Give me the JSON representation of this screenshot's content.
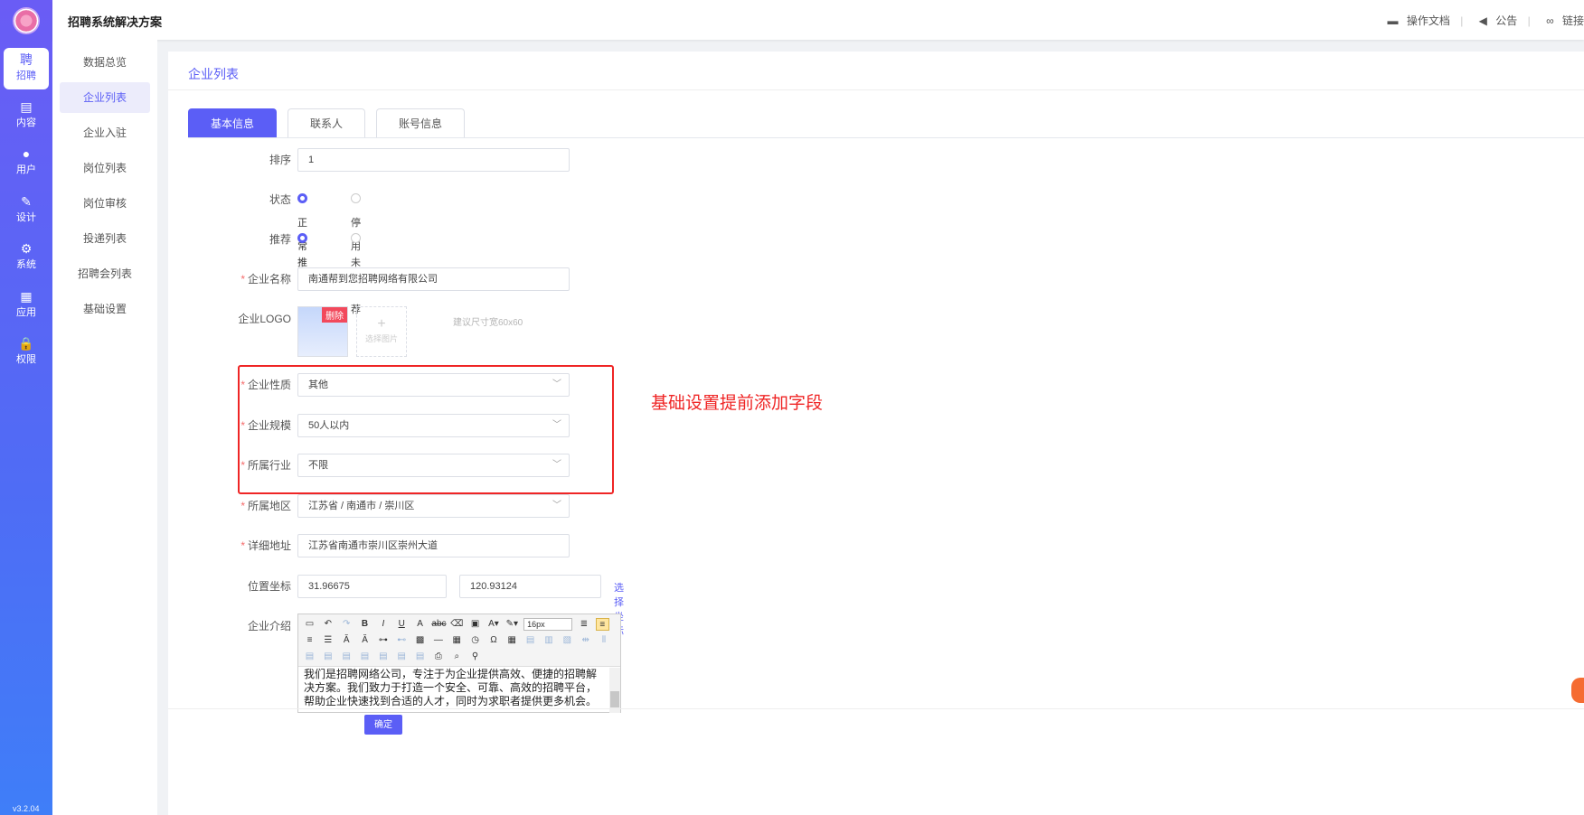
{
  "header": {
    "title": "招聘系统解决方案",
    "docs": "操作文档",
    "notice": "公告",
    "link": "链接"
  },
  "rail": {
    "items": [
      {
        "icon": "聘",
        "label": "招聘"
      },
      {
        "icon": "▤",
        "label": "内容"
      },
      {
        "icon": "●",
        "label": "用户"
      },
      {
        "icon": "✎",
        "label": "设计"
      },
      {
        "icon": "⚙",
        "label": "系统"
      },
      {
        "icon": "▦",
        "label": "应用"
      },
      {
        "icon": "🔒",
        "label": "权限"
      }
    ],
    "version": "v3.2.04"
  },
  "submenu": [
    "数据总览",
    "企业列表",
    "企业入驻",
    "岗位列表",
    "岗位审核",
    "投递列表",
    "招聘会列表",
    "基础设置"
  ],
  "page": {
    "title": "企业列表"
  },
  "tabs": [
    "基本信息",
    "联系人",
    "账号信息"
  ],
  "form": {
    "sort": {
      "label": "排序",
      "value": "1"
    },
    "status": {
      "label": "状态",
      "options": [
        "正常",
        "停用"
      ],
      "selected": "正常"
    },
    "recommend": {
      "label": "推荐",
      "options": [
        "推荐",
        "未推荐"
      ],
      "selected": "推荐"
    },
    "company_name": {
      "label": "企业名称",
      "value": "南通帮到您招聘网络有限公司"
    },
    "logo": {
      "label": "企业LOGO",
      "delete": "删除",
      "upload": "选择图片",
      "hint": "建议尺寸宽60x60"
    },
    "nature": {
      "label": "企业性质",
      "value": "其他"
    },
    "scale": {
      "label": "企业规模",
      "value": "50人以内"
    },
    "industry": {
      "label": "所属行业",
      "value": "不限"
    },
    "region": {
      "label": "所属地区",
      "value": "江苏省 / 南通市 / 崇川区"
    },
    "address": {
      "label": "详细地址",
      "value": "江苏省南通市崇川区崇州大道"
    },
    "coords": {
      "label": "位置坐标",
      "lat": "31.96675",
      "lng": "120.93124",
      "pick": "选择坐标"
    },
    "intro": {
      "label": "企业介绍",
      "font_size": "16px",
      "text": "我们是招聘网络公司，专注于为企业提供高效、便捷的招聘解决方案。我们致力于打造一个安全、可靠、高效的招聘平台，帮助企业快速找到合适的人才，同时为求职者提供更多机会。"
    }
  },
  "annotation": "基础设置提前添加字段",
  "confirm": "确定"
}
